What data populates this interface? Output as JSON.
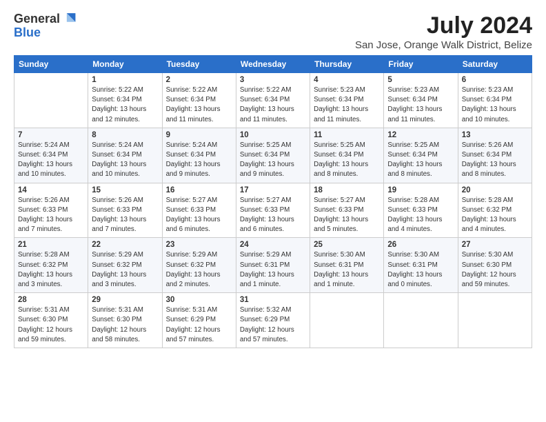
{
  "logo": {
    "general": "General",
    "blue": "Blue"
  },
  "title": "July 2024",
  "location": "San Jose, Orange Walk District, Belize",
  "headers": [
    "Sunday",
    "Monday",
    "Tuesday",
    "Wednesday",
    "Thursday",
    "Friday",
    "Saturday"
  ],
  "weeks": [
    [
      {
        "day": "",
        "info": ""
      },
      {
        "day": "1",
        "info": "Sunrise: 5:22 AM\nSunset: 6:34 PM\nDaylight: 13 hours\nand 12 minutes."
      },
      {
        "day": "2",
        "info": "Sunrise: 5:22 AM\nSunset: 6:34 PM\nDaylight: 13 hours\nand 11 minutes."
      },
      {
        "day": "3",
        "info": "Sunrise: 5:22 AM\nSunset: 6:34 PM\nDaylight: 13 hours\nand 11 minutes."
      },
      {
        "day": "4",
        "info": "Sunrise: 5:23 AM\nSunset: 6:34 PM\nDaylight: 13 hours\nand 11 minutes."
      },
      {
        "day": "5",
        "info": "Sunrise: 5:23 AM\nSunset: 6:34 PM\nDaylight: 13 hours\nand 11 minutes."
      },
      {
        "day": "6",
        "info": "Sunrise: 5:23 AM\nSunset: 6:34 PM\nDaylight: 13 hours\nand 10 minutes."
      }
    ],
    [
      {
        "day": "7",
        "info": "Sunrise: 5:24 AM\nSunset: 6:34 PM\nDaylight: 13 hours\nand 10 minutes."
      },
      {
        "day": "8",
        "info": "Sunrise: 5:24 AM\nSunset: 6:34 PM\nDaylight: 13 hours\nand 10 minutes."
      },
      {
        "day": "9",
        "info": "Sunrise: 5:24 AM\nSunset: 6:34 PM\nDaylight: 13 hours\nand 9 minutes."
      },
      {
        "day": "10",
        "info": "Sunrise: 5:25 AM\nSunset: 6:34 PM\nDaylight: 13 hours\nand 9 minutes."
      },
      {
        "day": "11",
        "info": "Sunrise: 5:25 AM\nSunset: 6:34 PM\nDaylight: 13 hours\nand 8 minutes."
      },
      {
        "day": "12",
        "info": "Sunrise: 5:25 AM\nSunset: 6:34 PM\nDaylight: 13 hours\nand 8 minutes."
      },
      {
        "day": "13",
        "info": "Sunrise: 5:26 AM\nSunset: 6:34 PM\nDaylight: 13 hours\nand 8 minutes."
      }
    ],
    [
      {
        "day": "14",
        "info": "Sunrise: 5:26 AM\nSunset: 6:33 PM\nDaylight: 13 hours\nand 7 minutes."
      },
      {
        "day": "15",
        "info": "Sunrise: 5:26 AM\nSunset: 6:33 PM\nDaylight: 13 hours\nand 7 minutes."
      },
      {
        "day": "16",
        "info": "Sunrise: 5:27 AM\nSunset: 6:33 PM\nDaylight: 13 hours\nand 6 minutes."
      },
      {
        "day": "17",
        "info": "Sunrise: 5:27 AM\nSunset: 6:33 PM\nDaylight: 13 hours\nand 6 minutes."
      },
      {
        "day": "18",
        "info": "Sunrise: 5:27 AM\nSunset: 6:33 PM\nDaylight: 13 hours\nand 5 minutes."
      },
      {
        "day": "19",
        "info": "Sunrise: 5:28 AM\nSunset: 6:33 PM\nDaylight: 13 hours\nand 4 minutes."
      },
      {
        "day": "20",
        "info": "Sunrise: 5:28 AM\nSunset: 6:32 PM\nDaylight: 13 hours\nand 4 minutes."
      }
    ],
    [
      {
        "day": "21",
        "info": "Sunrise: 5:28 AM\nSunset: 6:32 PM\nDaylight: 13 hours\nand 3 minutes."
      },
      {
        "day": "22",
        "info": "Sunrise: 5:29 AM\nSunset: 6:32 PM\nDaylight: 13 hours\nand 3 minutes."
      },
      {
        "day": "23",
        "info": "Sunrise: 5:29 AM\nSunset: 6:32 PM\nDaylight: 13 hours\nand 2 minutes."
      },
      {
        "day": "24",
        "info": "Sunrise: 5:29 AM\nSunset: 6:31 PM\nDaylight: 13 hours\nand 1 minute."
      },
      {
        "day": "25",
        "info": "Sunrise: 5:30 AM\nSunset: 6:31 PM\nDaylight: 13 hours\nand 1 minute."
      },
      {
        "day": "26",
        "info": "Sunrise: 5:30 AM\nSunset: 6:31 PM\nDaylight: 13 hours\nand 0 minutes."
      },
      {
        "day": "27",
        "info": "Sunrise: 5:30 AM\nSunset: 6:30 PM\nDaylight: 12 hours\nand 59 minutes."
      }
    ],
    [
      {
        "day": "28",
        "info": "Sunrise: 5:31 AM\nSunset: 6:30 PM\nDaylight: 12 hours\nand 59 minutes."
      },
      {
        "day": "29",
        "info": "Sunrise: 5:31 AM\nSunset: 6:30 PM\nDaylight: 12 hours\nand 58 minutes."
      },
      {
        "day": "30",
        "info": "Sunrise: 5:31 AM\nSunset: 6:29 PM\nDaylight: 12 hours\nand 57 minutes."
      },
      {
        "day": "31",
        "info": "Sunrise: 5:32 AM\nSunset: 6:29 PM\nDaylight: 12 hours\nand 57 minutes."
      },
      {
        "day": "",
        "info": ""
      },
      {
        "day": "",
        "info": ""
      },
      {
        "day": "",
        "info": ""
      }
    ]
  ]
}
